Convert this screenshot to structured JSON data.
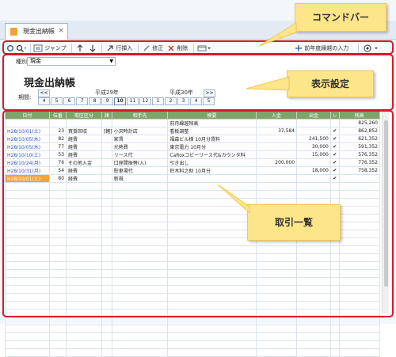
{
  "tab": {
    "title": "現金出納帳",
    "close": "×"
  },
  "callouts": {
    "command_bar": "コマンドバー",
    "display_settings": "表示設定",
    "transaction_list": "取引一覧"
  },
  "toolbar": {
    "jump": "ジャンプ",
    "insert_row": "行挿入",
    "correct": "修正",
    "delete": "削除",
    "previous_period_input": "前年度繰越の入力"
  },
  "settings": {
    "type_label": "種別:",
    "type_value": "現金",
    "title": "現金出納帳",
    "period_label": "期間:",
    "era_left": "平成29年",
    "era_right": "平成30年",
    "prev": "<<",
    "next": ">>",
    "months": [
      "4",
      "5",
      "6",
      "7",
      "8",
      "9",
      "10",
      "11",
      "12",
      "1",
      "2",
      "3",
      "4",
      "5"
    ],
    "selected_month": "10"
  },
  "grid": {
    "columns": [
      "日付",
      "伝番",
      "取区区分",
      "諸",
      "相手先",
      "摘要",
      "入金",
      "出金",
      "レ",
      "残高"
    ],
    "rows": [
      {
        "date": "",
        "no": "",
        "kind": "",
        "misc": "",
        "partner": "",
        "summary": "前月繰越残高",
        "in": "",
        "out": "",
        "check": "",
        "balance": "825,260"
      },
      {
        "date": "H28/10/01(土)",
        "no": "23",
        "kind": "買掛回収",
        "misc": "[轄]",
        "partner": "小沢時計店",
        "summary": "看板調整",
        "in": "37,584",
        "out": "",
        "check": "✔",
        "balance": "862,852"
      },
      {
        "date": "H28/10/05(水)",
        "no": "82",
        "kind": "経費",
        "misc": "",
        "partner": "家賃",
        "summary": "福森ビル様 10月分賃料",
        "in": "",
        "out": "241,500",
        "check": "✔",
        "balance": "621,352"
      },
      {
        "date": "H28/10/05(水)",
        "no": "77",
        "kind": "経費",
        "misc": "",
        "partner": "光熱費",
        "summary": "東京電力 10月分",
        "in": "",
        "out": "30,000",
        "check": "✔",
        "balance": "591,352"
      },
      {
        "date": "H28/10/10(土)",
        "no": "53",
        "kind": "経費",
        "misc": "",
        "partner": "リース代",
        "summary": "CaRoxコピーリース代&カウンタ料",
        "in": "",
        "out": "15,000",
        "check": "✔",
        "balance": "576,352"
      },
      {
        "date": "H28/10/24(月)",
        "no": "76",
        "kind": "その他入金",
        "misc": "",
        "partner": "口座間振替(入)",
        "summary": "引き出し",
        "in": "200,000",
        "out": "",
        "check": "✔",
        "balance": "776,352"
      },
      {
        "date": "H28/10/31(月)",
        "no": "54",
        "kind": "経費",
        "misc": "",
        "partner": "駐車場代",
        "summary": "鈴木料之助 10月分",
        "in": "",
        "out": "18,000",
        "check": "✔",
        "balance": "758,352"
      },
      {
        "date": "H28/10/01(土)",
        "no": "80",
        "kind": "経費",
        "misc": "",
        "partner": "新規",
        "summary": "",
        "in": "",
        "out": "",
        "check": "✔",
        "balance": ""
      }
    ]
  }
}
